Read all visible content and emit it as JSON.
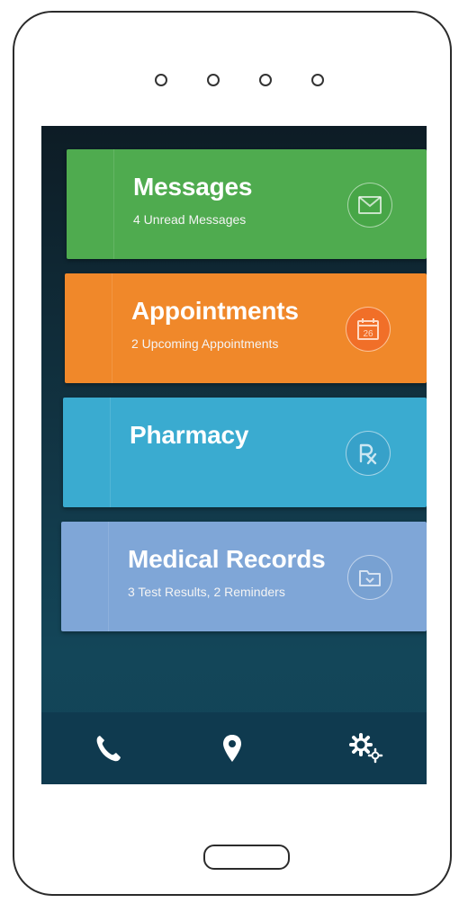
{
  "cards": [
    {
      "title": "Messages",
      "subtitle": "4 Unread Messages",
      "icon": "envelope-icon",
      "color": "#4fab4f"
    },
    {
      "title": "Appointments",
      "subtitle": "2 Upcoming Appointments",
      "icon": "calendar-icon",
      "icon_text": "26",
      "color": "#f0882a"
    },
    {
      "title": "Pharmacy",
      "subtitle": "",
      "icon": "rx-icon",
      "color": "#3aabd0"
    },
    {
      "title": "Medical Records",
      "subtitle": "3 Test Results, 2 Reminders",
      "icon": "folder-icon",
      "color": "#7fa6d7"
    }
  ],
  "tabbar": {
    "items": [
      {
        "icon": "phone-icon"
      },
      {
        "icon": "location-pin-icon"
      },
      {
        "icon": "settings-gears-icon"
      }
    ]
  }
}
